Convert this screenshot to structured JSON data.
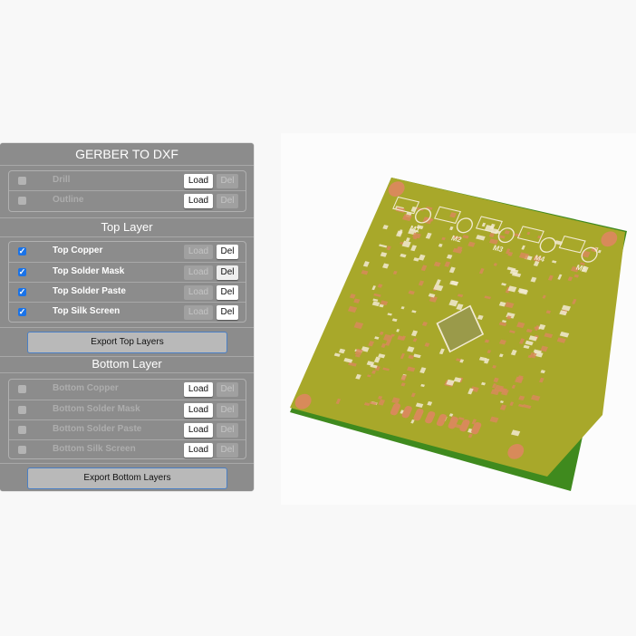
{
  "panel": {
    "title": "GERBER TO DXF",
    "general": [
      {
        "label": "Drill",
        "checked": false,
        "enabled": false,
        "load": "Load",
        "del": "Del"
      },
      {
        "label": "Outline",
        "checked": false,
        "enabled": false,
        "load": "Load",
        "del": "Del"
      }
    ],
    "top": {
      "header": "Top Layer",
      "layers": [
        {
          "label": "Top Copper",
          "checked": true,
          "load": "Load",
          "del": "Del"
        },
        {
          "label": "Top Solder Mask",
          "checked": true,
          "load": "Load",
          "del": "Del"
        },
        {
          "label": "Top Solder Paste",
          "checked": true,
          "load": "Load",
          "del": "Del"
        },
        {
          "label": "Top Silk Screen",
          "checked": true,
          "load": "Load",
          "del": "Del"
        }
      ],
      "export": "Export Top Layers"
    },
    "bottom": {
      "header": "Bottom Layer",
      "layers": [
        {
          "label": "Bottom Copper",
          "checked": false,
          "load": "Load",
          "del": "Del"
        },
        {
          "label": "Bottom Solder Mask",
          "checked": false,
          "load": "Load",
          "del": "Del"
        },
        {
          "label": "Bottom Solder Paste",
          "checked": false,
          "load": "Load",
          "del": "Del"
        },
        {
          "label": "Bottom Silk Screen",
          "checked": false,
          "load": "Load",
          "del": "Del"
        }
      ],
      "export": "Export Bottom Layers"
    }
  },
  "preview": {
    "silk_labels": [
      "M1",
      "M2",
      "M3",
      "M4",
      "M5"
    ],
    "colors": {
      "board": "#a8a82a",
      "edge": "#3f8a1e",
      "pad": "#d88a5a",
      "silk": "#f2ead2"
    }
  }
}
